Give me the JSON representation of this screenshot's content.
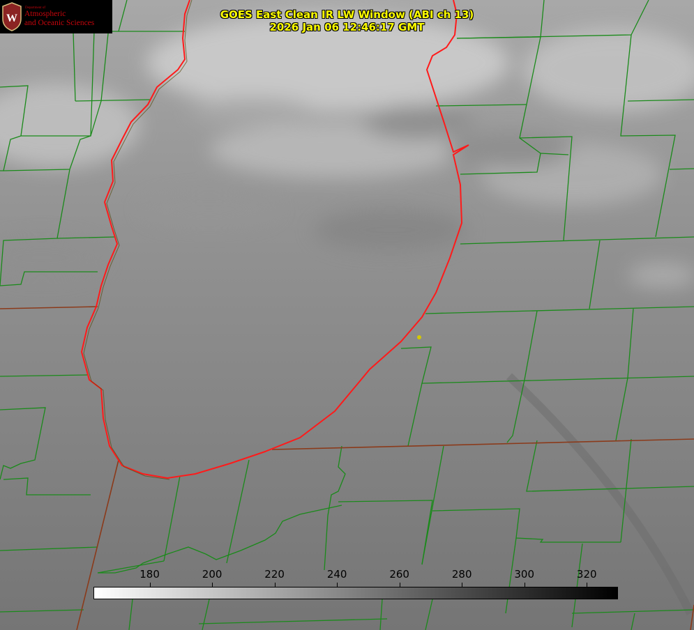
{
  "logo": {
    "department": "Department of",
    "name_line1": "Atmospheric",
    "name_line2": "and Oceanic Sciences",
    "shield_letter": "W"
  },
  "title": {
    "line1": "GOES East Clean IR LW Window (ABI ch 13)",
    "line2": "2026 Jan 06 12:46:17 GMT"
  },
  "colorbar": {
    "ticks": [
      "180",
      "200",
      "220",
      "240",
      "260",
      "280",
      "300",
      "320"
    ],
    "range": [
      162,
      330
    ],
    "gradient_from": "#ffffff",
    "gradient_to": "#000000"
  },
  "colors": {
    "background_gray": "#808080",
    "county_lines": "#1a8a1a",
    "state_lines": "#8b3a1a",
    "lake_outline": "#ff1a1a",
    "title_text": "#ffff00",
    "marker": "#d4c800",
    "logo_red": "#c5050c"
  },
  "map": {
    "features": [
      "lake-outline",
      "county-boundaries",
      "state-boundaries",
      "city-marker"
    ]
  }
}
